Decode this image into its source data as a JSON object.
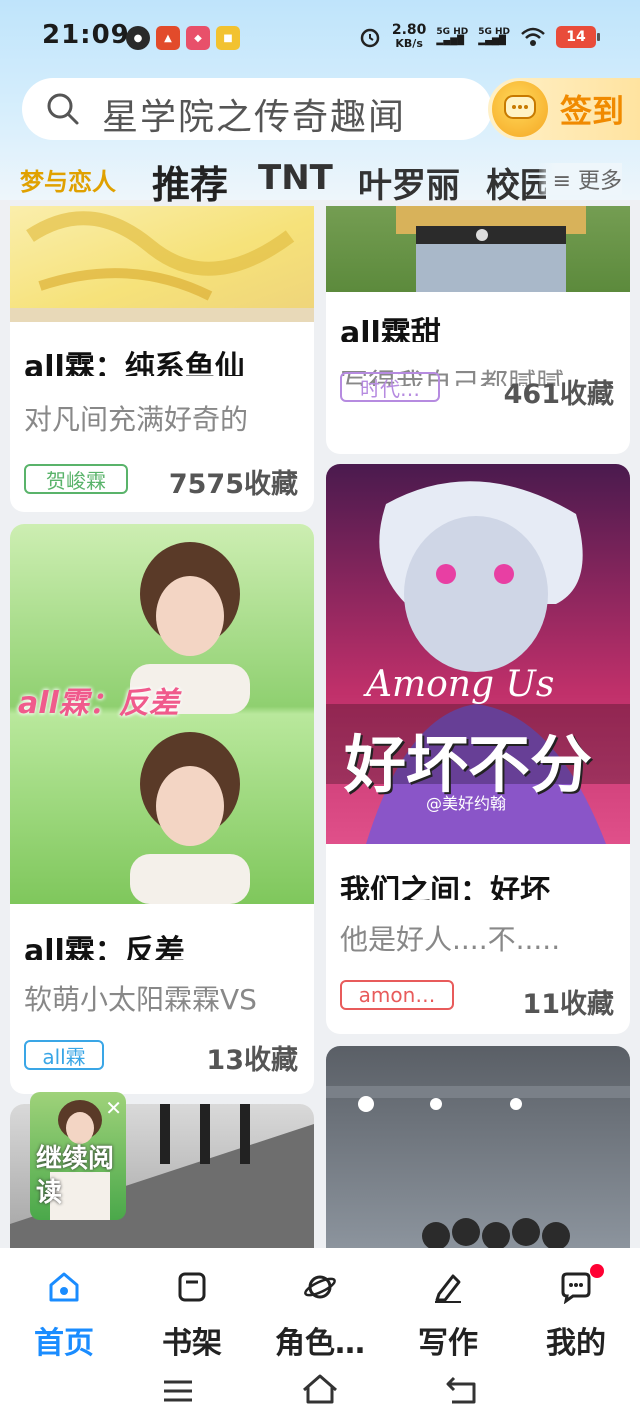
{
  "status": {
    "time": "21:09",
    "net_speed_value": "2.80",
    "net_speed_unit": "KB/s",
    "sig1": "5G HD",
    "sig2": "5G HD",
    "battery": "14"
  },
  "search": {
    "text": "星学院之传奇趣闻"
  },
  "signin": {
    "label": "签到"
  },
  "tabs": [
    {
      "label": "梦与恋人"
    },
    {
      "label": "推荐"
    },
    {
      "label": "TNT"
    },
    {
      "label": "叶罗丽"
    },
    {
      "label": "校园"
    }
  ],
  "more_label": "≡ 更多",
  "cards": [
    {
      "title": "all霖：纯系鱼仙",
      "desc": "对凡间充满好奇的",
      "tag": "贺峻霖",
      "tag_color": "#59b36a",
      "fav": "7575收藏"
    },
    {
      "title": "all霖甜",
      "desc": "写得我自己都腻腻",
      "tag": "时代…",
      "tag_color": "#b68be0",
      "fav": "461收藏"
    },
    {
      "title": "all霖：反差",
      "desc": "软萌小太阳霖霖VS",
      "tag": "all霖",
      "tag_color": "#3aa6e6",
      "cover_caption": "all霖：反差",
      "fav": "13收藏"
    },
    {
      "title": "我们之间：好坏",
      "desc": "他是好人....不.....",
      "tag": "amon…",
      "tag_color": "#e85b5b",
      "cover_caption_1": "Among Us",
      "cover_caption_2": "好坏不分",
      "cover_caption_3": "@美好约翰",
      "fav": "11收藏"
    }
  ],
  "float": {
    "text": "继续阅读"
  },
  "nav": [
    {
      "label": "首页"
    },
    {
      "label": "书架"
    },
    {
      "label": "角色…"
    },
    {
      "label": "写作"
    },
    {
      "label": "我的"
    }
  ],
  "colors": {
    "accent": "#1a8cff",
    "signin": "#f08a00",
    "tab_active": "#222222"
  }
}
